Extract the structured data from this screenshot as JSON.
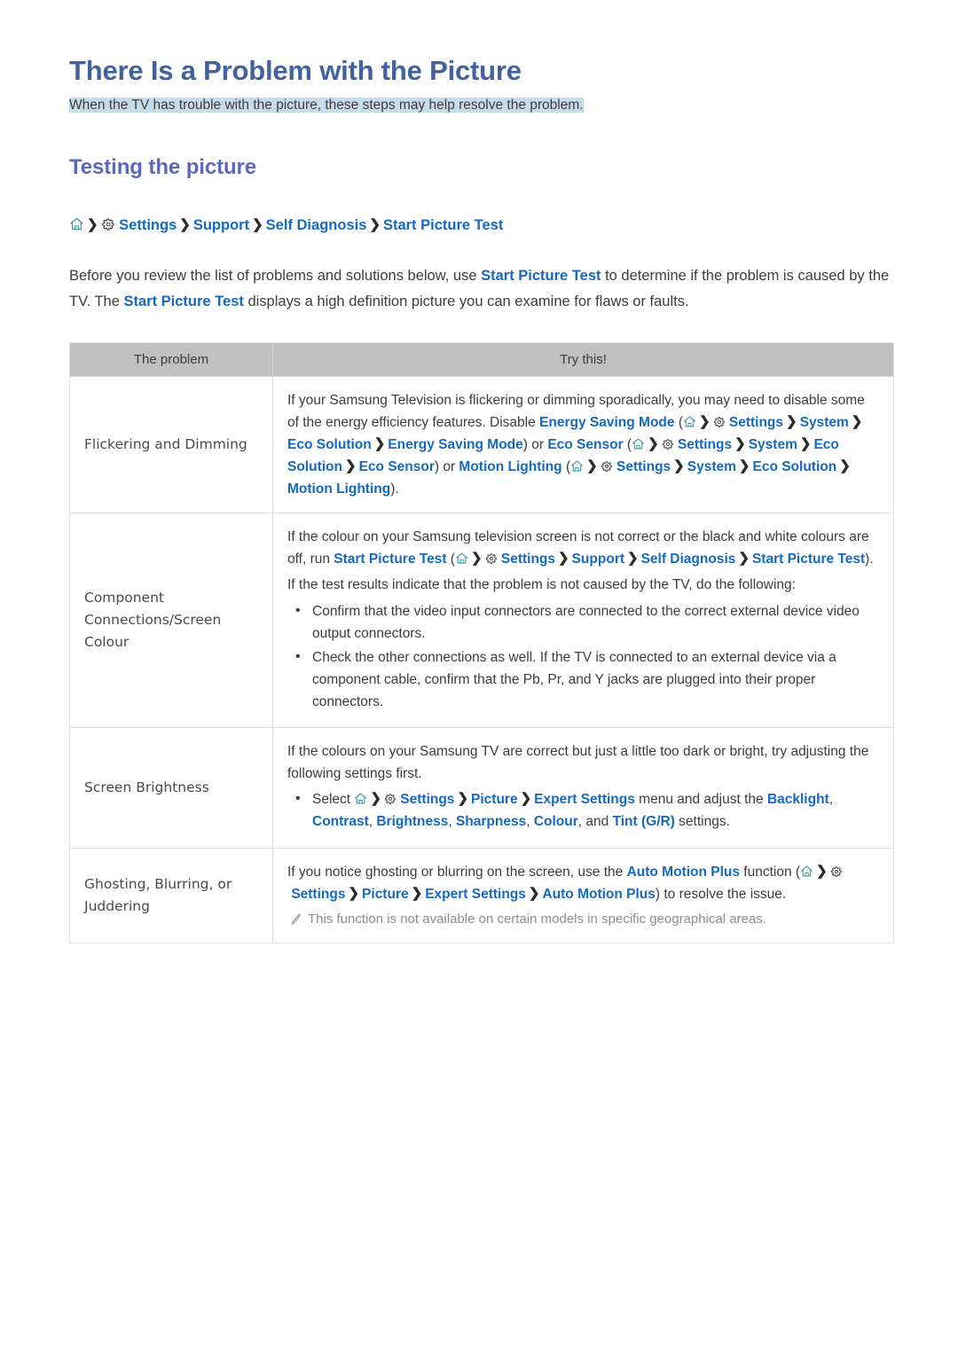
{
  "document": {
    "title": "There Is a Problem with the Picture",
    "subtitle": "When the TV has trouble with the picture, these steps may help resolve the problem.",
    "section_title": "Testing the picture"
  },
  "breadcrumb": {
    "home_icon": "home-icon",
    "gear_icon": "gear-icon",
    "separator": "❯",
    "items": [
      "Settings",
      "Support",
      "Self Diagnosis",
      "Start Picture Test"
    ]
  },
  "intro": {
    "part1": "Before you review the list of problems and solutions below, use ",
    "link1": "Start Picture Test",
    "part2": " to determine if the problem is caused by the TV. The ",
    "link2": "Start Picture Test",
    "part3": " displays a high definition picture you can examine for flaws or faults."
  },
  "table": {
    "headers": [
      "The problem",
      "Try this!"
    ],
    "rows": [
      {
        "problem": "Flickering and Dimming",
        "solution": {
          "p1_a": "If your Samsung Television is flickering or dimming sporadically, you may need to disable some of the energy efficiency features. Disable ",
          "l_energy_saving_mode": "Energy Saving Mode",
          "paren_open": "(",
          "l_settings": "Settings",
          "l_system": "System",
          "l_eco_solution": "Eco Solution",
          "l_energy_saving_mode2": "Energy Saving Mode",
          "paren_close_or": ") or ",
          "l_eco_sensor": "Eco Sensor",
          "l_settings2": "Settings",
          "l_system2": "System",
          "l_eco_solution2": "Eco Solution",
          "l_eco_sensor2": "Eco Sensor",
          "paren_close_or2": ") or ",
          "l_motion_lighting": "Motion Lighting",
          "l_settings3": "Settings",
          "l_system3": "System",
          "l_eco_solution3": "Eco Solution",
          "l_motion_lighting2": "Motion Lighting",
          "end": ")."
        }
      },
      {
        "problem": "Component Connections/Screen Colour",
        "solution": {
          "p1_a": "If the colour on your Samsung television screen is not correct or the black and white colours are off, run ",
          "l_start_picture_test": "Start Picture Test",
          "paren_open": "(",
          "l_settings": "Settings",
          "l_support": "Support",
          "l_self_diagnosis": "Self Diagnosis",
          "l_start_picture_test2": "Start Picture Test",
          "end": ").",
          "p2": "If the test results indicate that the problem is not caused by the TV, do the following:",
          "bullets": [
            "Confirm that the video input connectors are connected to the correct external device video output connectors.",
            "Check the other connections as well. If the TV is connected to an external device via a component cable, confirm that the Pb, Pr, and Y jacks are plugged into their proper connectors."
          ]
        }
      },
      {
        "problem": "Screen Brightness",
        "solution": {
          "p1": "If the colours on your Samsung TV are correct but just a little too dark or bright, try adjusting the following settings first.",
          "b_select": "Select ",
          "l_settings": "Settings",
          "l_picture": "Picture",
          "l_expert_settings": "Expert Settings",
          "b_mid": " menu and adjust the ",
          "l_backlight": "Backlight",
          "l_contrast": "Contrast",
          "l_brightness": "Brightness",
          "l_sharpness": "Sharpness",
          "l_colour": "Colour",
          "and_text": ", and ",
          "l_tint": "Tint (G/R)",
          "b_end": " settings."
        }
      },
      {
        "problem": "Ghosting, Blurring, or Juddering",
        "solution": {
          "p1_a": "If you notice ghosting or blurring on the screen, use the ",
          "l_auto_motion_plus": "Auto Motion Plus",
          "p1_b": " function (",
          "l_settings": "Settings",
          "l_picture": "Picture",
          "l_expert_settings": "Expert Settings",
          "l_auto_motion_plus2": "Auto Motion Plus",
          "end": ") to resolve the issue.",
          "note_icon": "pencil-icon",
          "note": "This function is not available on certain models in specific geographical areas."
        }
      }
    ]
  },
  "colors": {
    "title_blue": "#41619f",
    "section_blue": "#5a68bf",
    "link_blue": "#1569c0",
    "highlight": "#c6dceb",
    "header_gray": "#c1c1c1",
    "body_text": "#3c3c3c",
    "note_gray": "#8e8e8e",
    "home_icon_teal": "#2a8fa0"
  }
}
